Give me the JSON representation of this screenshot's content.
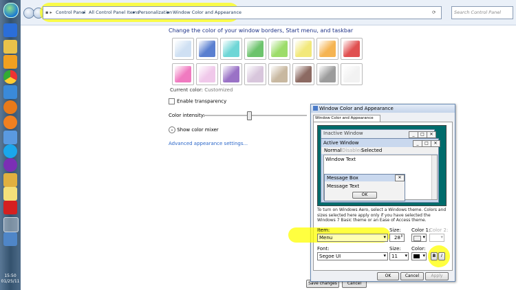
{
  "taskbar": {
    "time": "15:50",
    "date": "01/25/11"
  },
  "address": {
    "crumbs": [
      "Control Panel",
      "All Control Panel Items",
      "Personalization",
      "Window Color and Appearance"
    ],
    "search_placeholder": "Search Control Panel"
  },
  "main": {
    "heading": "Change the color of your window borders, Start menu, and taskbar",
    "current_color_label": "Current color:",
    "current_color_value": "Customized",
    "enable_transparency": "Enable transparency",
    "color_intensity": "Color intensity:",
    "show_color_mixer": "Show color mixer",
    "advanced_link": "Advanced appearance settings...",
    "save_button": "Save changes",
    "cancel_button": "Cancel",
    "swatches_row1": [
      "#cfe0f3",
      "#5a7fd0",
      "#6fd6d6",
      "#6cc36c",
      "#9cdc6a",
      "#f2e87a",
      "#f5b452",
      "#e05050"
    ],
    "swatches_row2": [
      "#f07ac0",
      "#f0c8ea",
      "#9a72c6",
      "#d8c6dc",
      "#c8b8a0",
      "#8c6a62",
      "#9c9c9c",
      "#f2f2f2"
    ]
  },
  "dialog": {
    "title": "Window Color and Appearance",
    "tab": "Window Color and Appearance",
    "preview": {
      "inactive_window": "Inactive Window",
      "active_window": "Active Window",
      "menu_normal": "Normal",
      "menu_disabled": "Disabled",
      "menu_selected": "Selected",
      "window_text": "Window Text",
      "message_box": "Message Box",
      "message_text": "Message Text",
      "ok": "OK"
    },
    "info_text": "To turn on Windows Aero, select a Windows theme. Colors and sizes selected here apply only if you have selected the Windows 7 Basic theme or an Ease of Access theme.",
    "item_label": "Item:",
    "item_value": "Menu",
    "size_label": "Size:",
    "size_value": "28",
    "color1_label": "Color 1:",
    "color2_label": "Color 2:",
    "font_label": "Font:",
    "font_value": "Segoe UI",
    "font_size_label": "Size:",
    "font_size_value": "11",
    "font_color_label": "Color:",
    "bold": "B",
    "italic": "I",
    "ok_button": "OK",
    "cancel_button": "Cancel",
    "apply_button": "Apply"
  }
}
